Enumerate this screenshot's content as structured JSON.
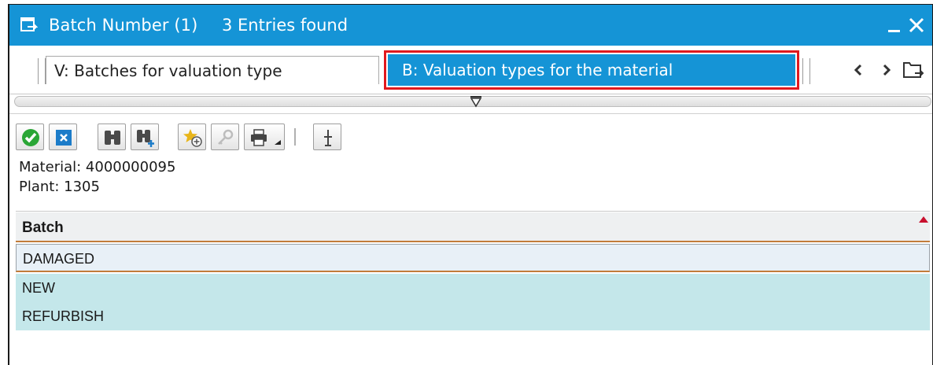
{
  "titlebar": {
    "title": "Batch Number (1)",
    "entries": "3 Entries found",
    "icons": [
      "window-icon",
      "minimize-icon",
      "close-icon"
    ]
  },
  "tabs": [
    {
      "label": "V: Batches for valuation type",
      "active": false
    },
    {
      "label": "B: Valuation types for the material",
      "active": true
    }
  ],
  "nav_icons": [
    "chevron-left-icon",
    "chevron-right-icon",
    "tab-list-icon"
  ],
  "toolbar": {
    "buttons": [
      "check-icon",
      "cancel-icon",
      "find-icon",
      "find-next-icon",
      "add-favorite-icon",
      "key-icon",
      "print-icon",
      "insert-icon"
    ]
  },
  "info": {
    "material": "Material: 4000000095",
    "plant": "Plant: 1305"
  },
  "table": {
    "header": "Batch",
    "rows": [
      "DAMAGED",
      "NEW",
      "REFURBISH"
    ]
  },
  "colors": {
    "titlebar": "#1594d6",
    "active_tab": "#1594d6",
    "highlight_border": "#e0191e",
    "row": "#c4e7ea",
    "header_line": "#c27c3a"
  }
}
